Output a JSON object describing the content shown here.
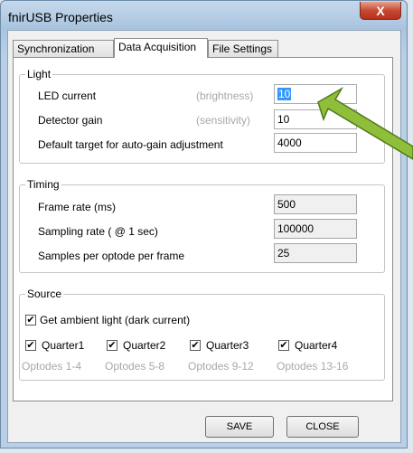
{
  "window": {
    "title": "fnirUSB Properties",
    "close_glyph": "X"
  },
  "tabs": [
    {
      "label": "Synchronization"
    },
    {
      "label": "Data Acquisition"
    },
    {
      "label": "File Settings"
    }
  ],
  "light": {
    "legend": "Light",
    "led_label": "LED current",
    "led_hint": "(brightness)",
    "led_value": "10",
    "gain_label": "Detector gain",
    "gain_hint": "(sensitivity)",
    "gain_value": "10",
    "target_label": "Default target for auto-gain adjustment",
    "target_value": "4000"
  },
  "timing": {
    "legend": "Timing",
    "frame_label": "Frame rate (ms)",
    "frame_value": "500",
    "sampling_label": "Sampling rate ( @ 1 sec)",
    "sampling_value": "100000",
    "samples_label": "Samples per optode per frame",
    "samples_value": "25"
  },
  "source": {
    "legend": "Source",
    "ambient_label": "Get ambient light (dark current)",
    "quarters": [
      {
        "label": "Quarter1",
        "optodes": "Optodes 1-4"
      },
      {
        "label": "Quarter2",
        "optodes": "Optodes 5-8"
      },
      {
        "label": "Quarter3",
        "optodes": "Optodes 9-12"
      },
      {
        "label": "Quarter4",
        "optodes": "Optodes 13-16"
      }
    ],
    "check_glyph": "✔"
  },
  "buttons": {
    "save": "SAVE",
    "close": "CLOSE"
  }
}
